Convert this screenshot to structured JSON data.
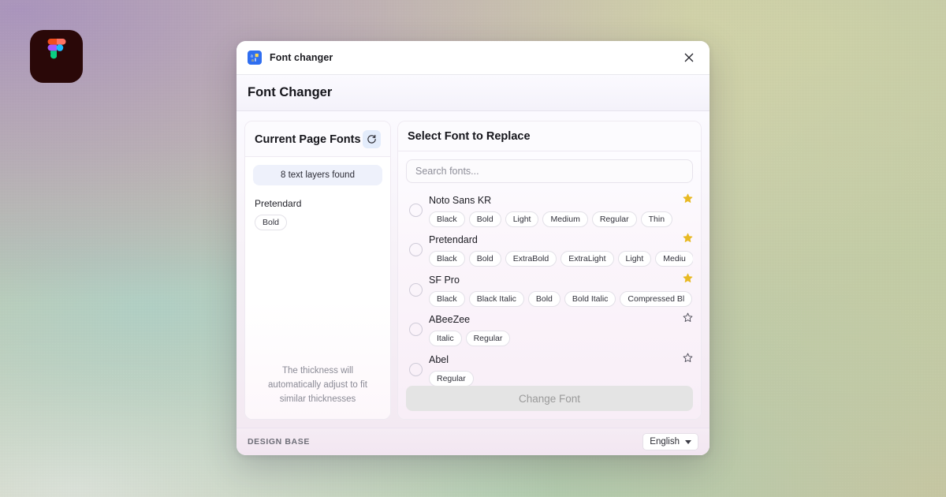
{
  "desktop": {
    "figma_logo": "figma-logo"
  },
  "window": {
    "app_icon": "translate-icon",
    "title": "Font changer",
    "close_icon": "close-icon"
  },
  "header": {
    "title": "Font Changer"
  },
  "left_panel": {
    "title": "Current Page Fonts",
    "refresh_icon": "refresh-icon",
    "layers_badge": "8 text layers found",
    "fonts": [
      {
        "name": "Pretendard",
        "weights": [
          "Bold"
        ]
      }
    ],
    "footer_note": "The thickness will automatically adjust to fit similar thicknesses"
  },
  "right_panel": {
    "title": "Select Font to Replace",
    "search": {
      "placeholder": "Search fonts...",
      "value": ""
    },
    "fonts": [
      {
        "name": "Noto Sans KR",
        "favorite": true,
        "selected": false,
        "weights": [
          "Black",
          "Bold",
          "Light",
          "Medium",
          "Regular",
          "Thin"
        ]
      },
      {
        "name": "Pretendard",
        "favorite": true,
        "selected": false,
        "weights": [
          "Black",
          "Bold",
          "ExtraBold",
          "ExtraLight",
          "Light",
          "Mediu"
        ]
      },
      {
        "name": "SF Pro",
        "favorite": true,
        "selected": false,
        "weights": [
          "Black",
          "Black Italic",
          "Bold",
          "Bold Italic",
          "Compressed Bl"
        ]
      },
      {
        "name": "ABeeZee",
        "favorite": false,
        "selected": false,
        "weights": [
          "Italic",
          "Regular"
        ]
      },
      {
        "name": "Abel",
        "favorite": false,
        "selected": false,
        "weights": [
          "Regular"
        ]
      }
    ],
    "change_button": {
      "label": "Change Font",
      "disabled": true
    }
  },
  "footer": {
    "brand": "DESIGN BASE",
    "language": "English",
    "chevron_icon": "chevron-down-icon"
  },
  "colors": {
    "accent_blue": "#2f6ef0",
    "star_gold": "#e8b923",
    "refresh_bg": "#e3ecfb",
    "disabled_btn": "#e4e4e4"
  }
}
